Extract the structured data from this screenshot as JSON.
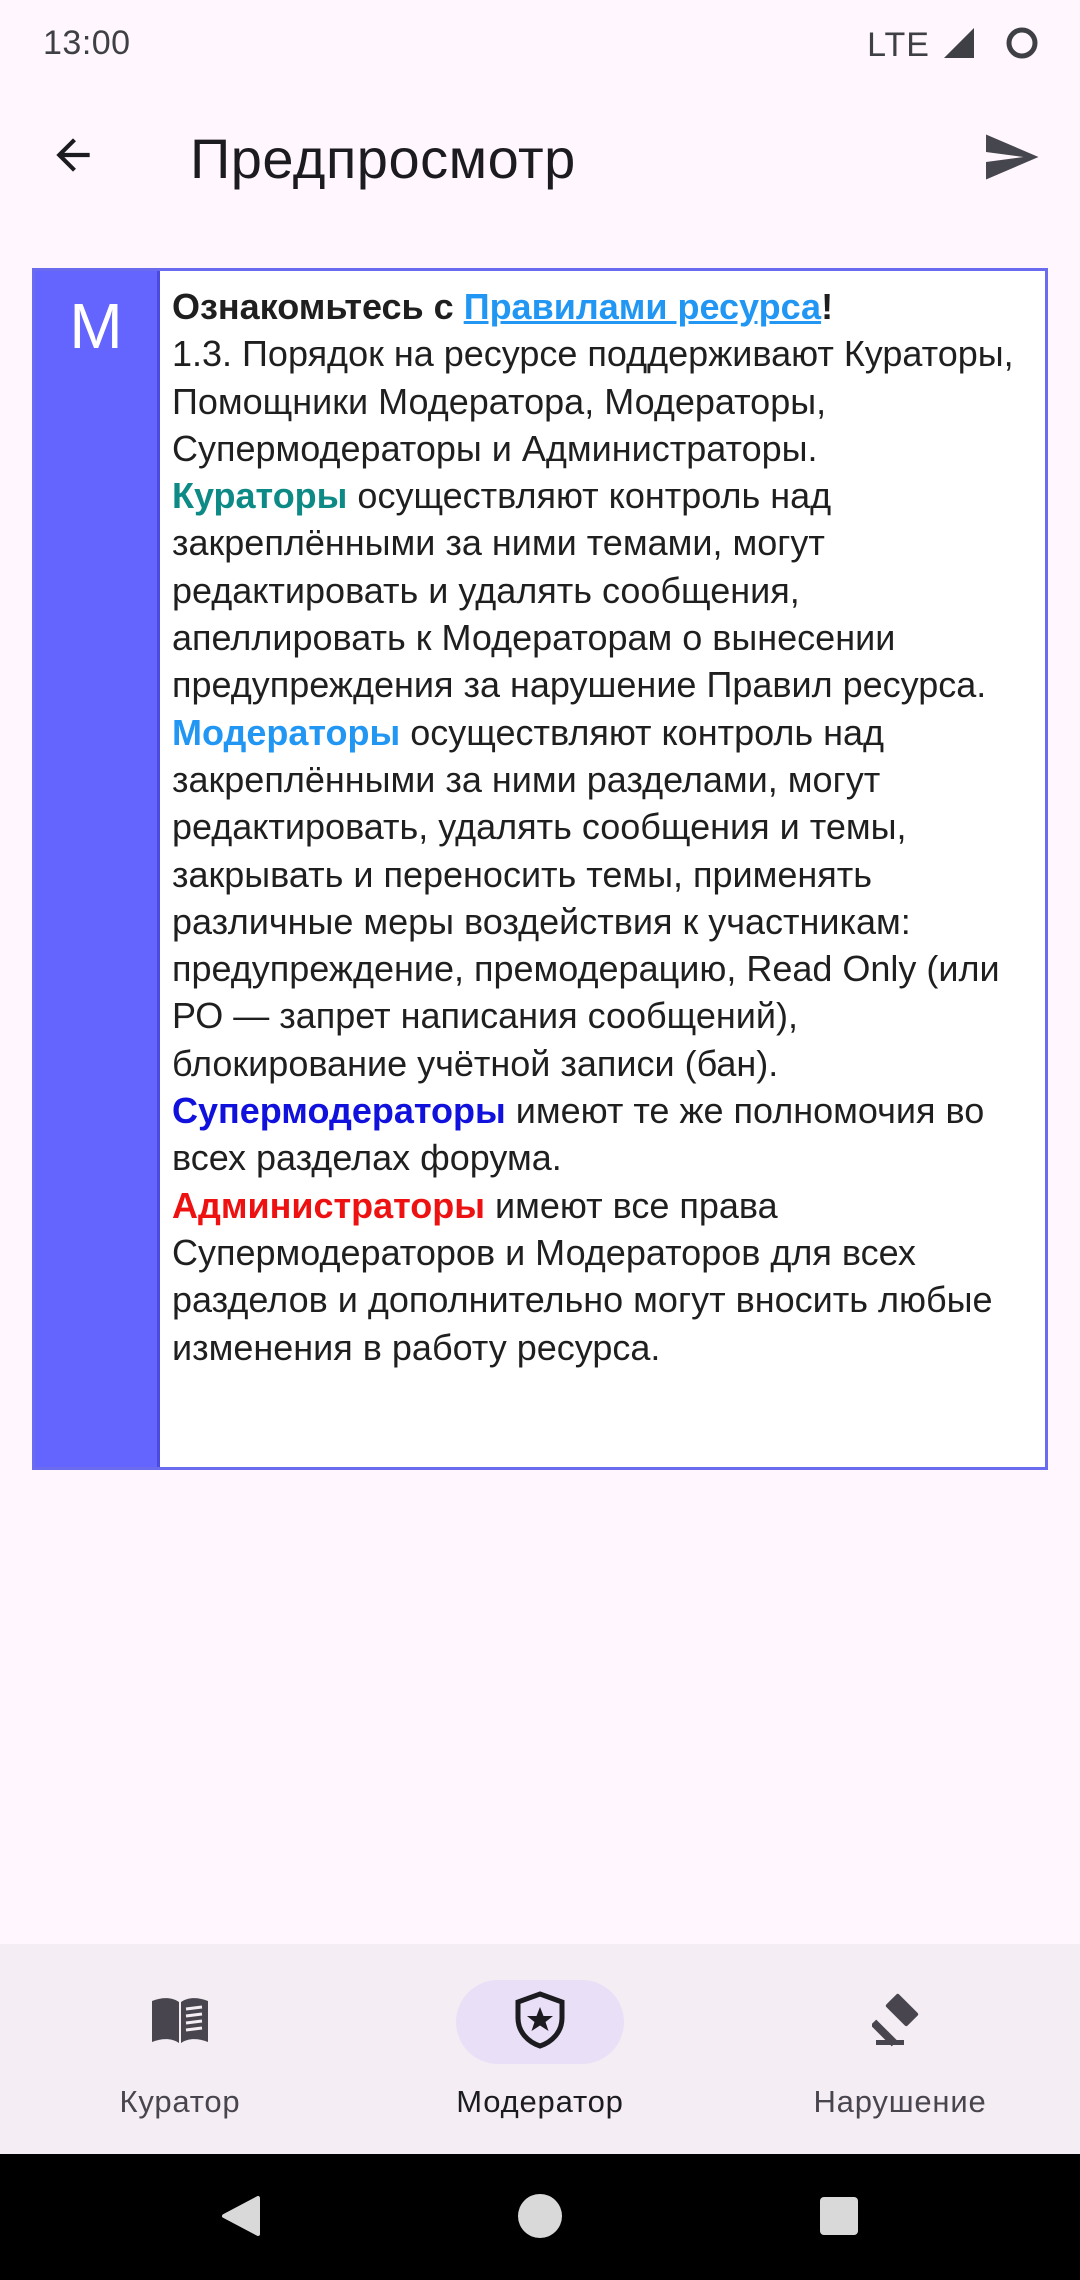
{
  "status_bar": {
    "time": "13:00",
    "network": "LTE"
  },
  "app_bar": {
    "title": "Предпросмотр",
    "back_icon": "arrow-back-icon",
    "send_icon": "send-icon"
  },
  "preview": {
    "badge": "M",
    "badge_color": "#6464FF",
    "intro": {
      "prefix": "Ознакомьтесь с ",
      "link": "Правилами ресурса",
      "suffix": "!"
    },
    "rule_intro": "1.3. Порядок на ресурсе поддерживают Кураторы, Помощники Модератора, Модераторы, Супермодераторы и Администраторы.",
    "curators": {
      "name": "Кураторы",
      "text": " осуществляют контроль над закреплёнными за ними темами, могут редактировать и удалять сообщения, апеллировать к Модераторам о вынесении предупреждения за нарушение Правил ресурса.",
      "color": "#0E8A86"
    },
    "moderators": {
      "name": "Модераторы",
      "text": " осуществляют контроль над закреплёнными за ними разделами, могут редактировать, удалять сообщения и темы, закрывать и переносить темы, применять различные меры воздействия к участникам: предупреждение, премодерацию, Read Only (или РО — запрет написания сообщений), блокирование учётной записи (бан).",
      "color": "#2196F3"
    },
    "supermoderators": {
      "name": "Супермодераторы",
      "text": " имеют те же полномочия во всех разделах форума.",
      "color": "#1111DD"
    },
    "administrators": {
      "name": "Администраторы",
      "text": " имеют все права Супермодераторов и Модераторов для всех разделов и дополнительно могут вносить любые изменения в работу ресурса.",
      "color": "#EE1111"
    }
  },
  "bottom_nav": {
    "items": [
      {
        "label": "Куратор",
        "icon": "book-icon",
        "active": false
      },
      {
        "label": "Модератор",
        "icon": "shield-star-icon",
        "active": true
      },
      {
        "label": "Нарушение",
        "icon": "gavel-icon",
        "active": false
      }
    ]
  },
  "system_nav": {
    "back": "nav-back-icon",
    "home": "nav-home-icon",
    "recents": "nav-recents-icon"
  }
}
